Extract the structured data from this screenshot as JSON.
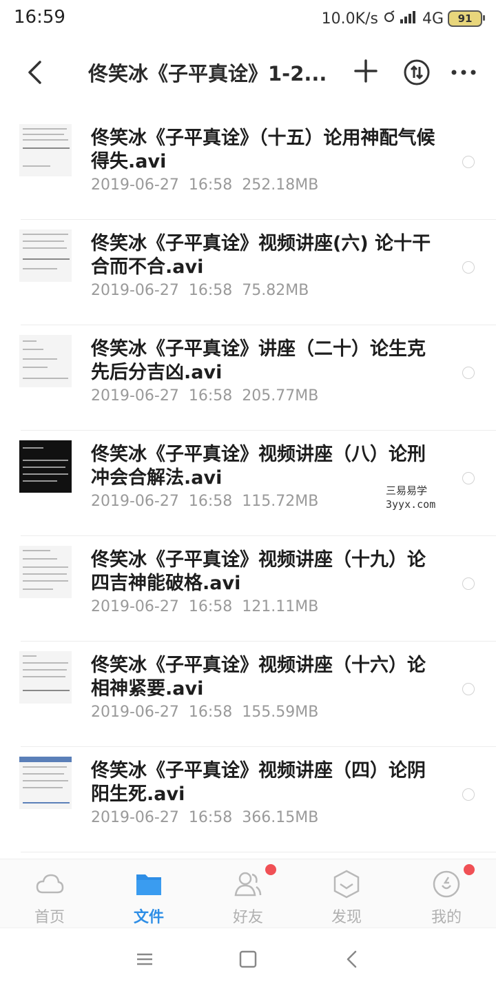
{
  "status_bar": {
    "time": "16:59",
    "net_speed": "10.0K/s",
    "network": "4G",
    "battery": "91"
  },
  "header": {
    "title": "佟笑冰《子平真诠》1-2..."
  },
  "files": [
    {
      "name": "佟笑冰《子平真诠》（十五）论用神配气候得失.avi",
      "date": "2019-06-27",
      "time": "16:58",
      "size": "252.18MB",
      "thumb": "light"
    },
    {
      "name": "佟笑冰《子平真诠》视频讲座(六) 论十干合而不合.avi",
      "date": "2019-06-27",
      "time": "16:58",
      "size": "75.82MB",
      "thumb": "light"
    },
    {
      "name": "佟笑冰《子平真诠》讲座（二十）论生克先后分吉凶.avi",
      "date": "2019-06-27",
      "time": "16:58",
      "size": "205.77MB",
      "thumb": "light"
    },
    {
      "name": "佟笑冰《子平真诠》视频讲座（八）论刑冲会合解法.avi",
      "date": "2019-06-27",
      "time": "16:58",
      "size": "115.72MB",
      "thumb": "dark"
    },
    {
      "name": "佟笑冰《子平真诠》视频讲座（十九）论四吉神能破格.avi",
      "date": "2019-06-27",
      "time": "16:58",
      "size": "121.11MB",
      "thumb": "light"
    },
    {
      "name": "佟笑冰《子平真诠》视频讲座（十六）论相神紧要.avi",
      "date": "2019-06-27",
      "time": "16:58",
      "size": "155.59MB",
      "thumb": "light"
    },
    {
      "name": "佟笑冰《子平真诠》视频讲座（四）论阴阳生死.avi",
      "date": "2019-06-27",
      "time": "16:58",
      "size": "366.15MB",
      "thumb": "blue"
    }
  ],
  "watermark": {
    "line1": "三易易学",
    "line2": "3yyx.com"
  },
  "bottom_nav": [
    {
      "label": "首页",
      "icon": "cloud-icon",
      "active": false
    },
    {
      "label": "文件",
      "icon": "folder-icon",
      "active": true
    },
    {
      "label": "好友",
      "icon": "friends-icon",
      "active": false,
      "badge": true
    },
    {
      "label": "发现",
      "icon": "discover-icon",
      "active": false
    },
    {
      "label": "我的",
      "icon": "profile-icon",
      "active": false,
      "badge": true
    }
  ],
  "colors": {
    "accent": "#2e8ee6",
    "badge": "#f05055",
    "meta_text": "#9a9a9a"
  }
}
